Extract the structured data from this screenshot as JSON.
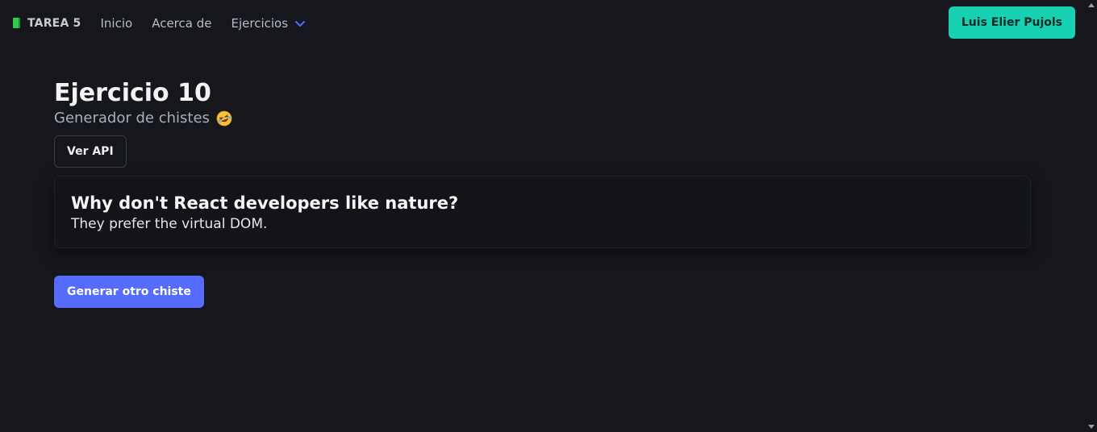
{
  "nav": {
    "brand": "TAREA 5",
    "links": [
      "Inicio",
      "Acerca de",
      "Ejercicios"
    ],
    "user_button": "Luis Elier Pujols"
  },
  "main": {
    "title": "Ejercicio 10",
    "subtitle": "Generador de chistes",
    "api_button": "Ver API",
    "joke": {
      "setup": "Why don't React developers like nature?",
      "punchline": "They prefer the virtual DOM."
    },
    "generate_button": "Generar otro chiste"
  },
  "icons": {
    "brand": "green-book-icon",
    "dropdown": "chevron-down-icon",
    "subtitle_emoji": "rolling-on-floor-laughing-emoji-icon"
  },
  "colors": {
    "background": "#15171c",
    "accent_teal": "#17d1b2",
    "accent_blue": "#566cff",
    "chevron": "#4f6bff"
  }
}
